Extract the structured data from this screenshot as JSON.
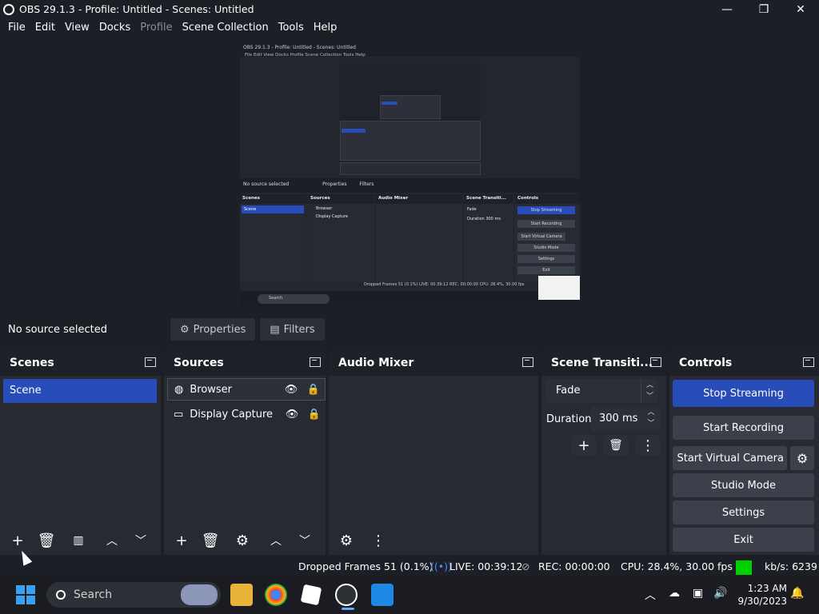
{
  "window": {
    "title": "OBS 29.1.3 - Profile: Untitled - Scenes: Untitled",
    "minimize": "—",
    "maximize": "❐",
    "close": "✕"
  },
  "menu": {
    "file": "File",
    "edit": "Edit",
    "view": "View",
    "docks": "Docks",
    "profile": "Profile",
    "scene_collection": "Scene Collection",
    "tools": "Tools",
    "help": "Help"
  },
  "preview_mini": {
    "title": "OBS 29.1.3 - Profile: Untitled - Scenes: Untitled",
    "menu": "File  Edit  View  Docks  Profile  Scene Collection  Tools  Help",
    "no_source": "No source selected",
    "properties": "Properties",
    "filters": "Filters",
    "scenes": "Scenes",
    "sources": "Sources",
    "audio_mixer": "Audio Mixer",
    "scene_transitions": "Scene Transiti...",
    "controls": "Controls",
    "scene": "Scene",
    "browser": "Browser",
    "display_capture": "Display Capture",
    "fade": "Fade",
    "duration": "Duration",
    "duration_value": "300 ms",
    "stop_streaming": "Stop Streaming",
    "start_recording": "Start Recording",
    "start_virtual_camera": "Start Virtual Camera",
    "studio_mode": "Studio Mode",
    "settings": "Settings",
    "exit": "Exit",
    "status": "Dropped Frames 51 (0.1%)   LIVE: 00:39:12   REC: 00:00:00   CPU: 28.4%, 30.00 fps",
    "search": "Search"
  },
  "source_bar": {
    "no_source": "No source selected",
    "properties": "Properties",
    "filters": "Filters"
  },
  "docks": {
    "scenes": {
      "title": "Scenes",
      "items": [
        "Scene"
      ]
    },
    "sources": {
      "title": "Sources",
      "items": [
        "Browser",
        "Display Capture"
      ]
    },
    "audio_mixer": {
      "title": "Audio Mixer"
    },
    "transitions": {
      "title": "Scene Transiti...",
      "selected": "Fade",
      "duration_label": "Duration",
      "duration_value": "300 ms"
    },
    "controls": {
      "title": "Controls",
      "stop_streaming": "Stop Streaming",
      "start_recording": "Start Recording",
      "start_virtual_camera": "Start Virtual Camera",
      "studio_mode": "Studio Mode",
      "settings": "Settings",
      "exit": "Exit"
    }
  },
  "status": {
    "dropped_frames": "Dropped Frames 51 (0.1%)",
    "live": "LIVE: 00:39:12",
    "rec": "REC: 00:00:00",
    "cpu": "CPU: 28.4%, 30.00 fps",
    "kbps": "kb/s: 6239",
    "health_color": "#00d000"
  },
  "taskbar": {
    "search": "Search",
    "time": "1:23 AM",
    "date": "9/30/2023"
  },
  "colors": {
    "accent": "#284cb8",
    "panel": "#272a33",
    "background": "#1d1f26"
  }
}
